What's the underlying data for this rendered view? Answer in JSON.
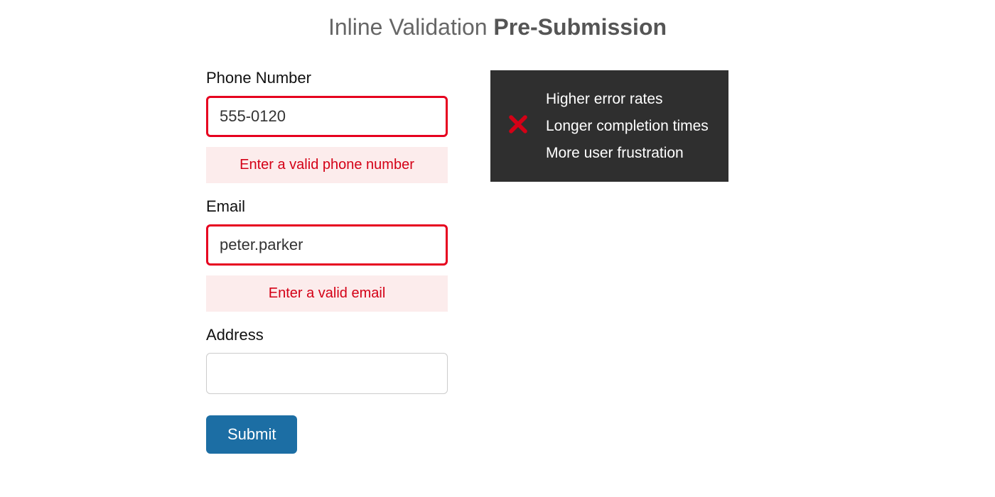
{
  "title": {
    "light": "Inline Validation ",
    "bold": "Pre-Submission"
  },
  "form": {
    "phone": {
      "label": "Phone Number",
      "value": "555-0120",
      "error": "Enter a valid phone number"
    },
    "email": {
      "label": "Email",
      "value": "peter.parker",
      "error": "Enter a valid email"
    },
    "address": {
      "label": "Address",
      "value": ""
    },
    "submit_label": "Submit"
  },
  "callout": {
    "icon": "x-icon",
    "items": [
      "Higher error rates",
      "Longer completion times",
      "More user frustration"
    ]
  },
  "colors": {
    "error": "#e6001f",
    "error_bg": "#fcecec",
    "submit": "#1c6ea4",
    "callout_bg": "#2f2f2f"
  }
}
